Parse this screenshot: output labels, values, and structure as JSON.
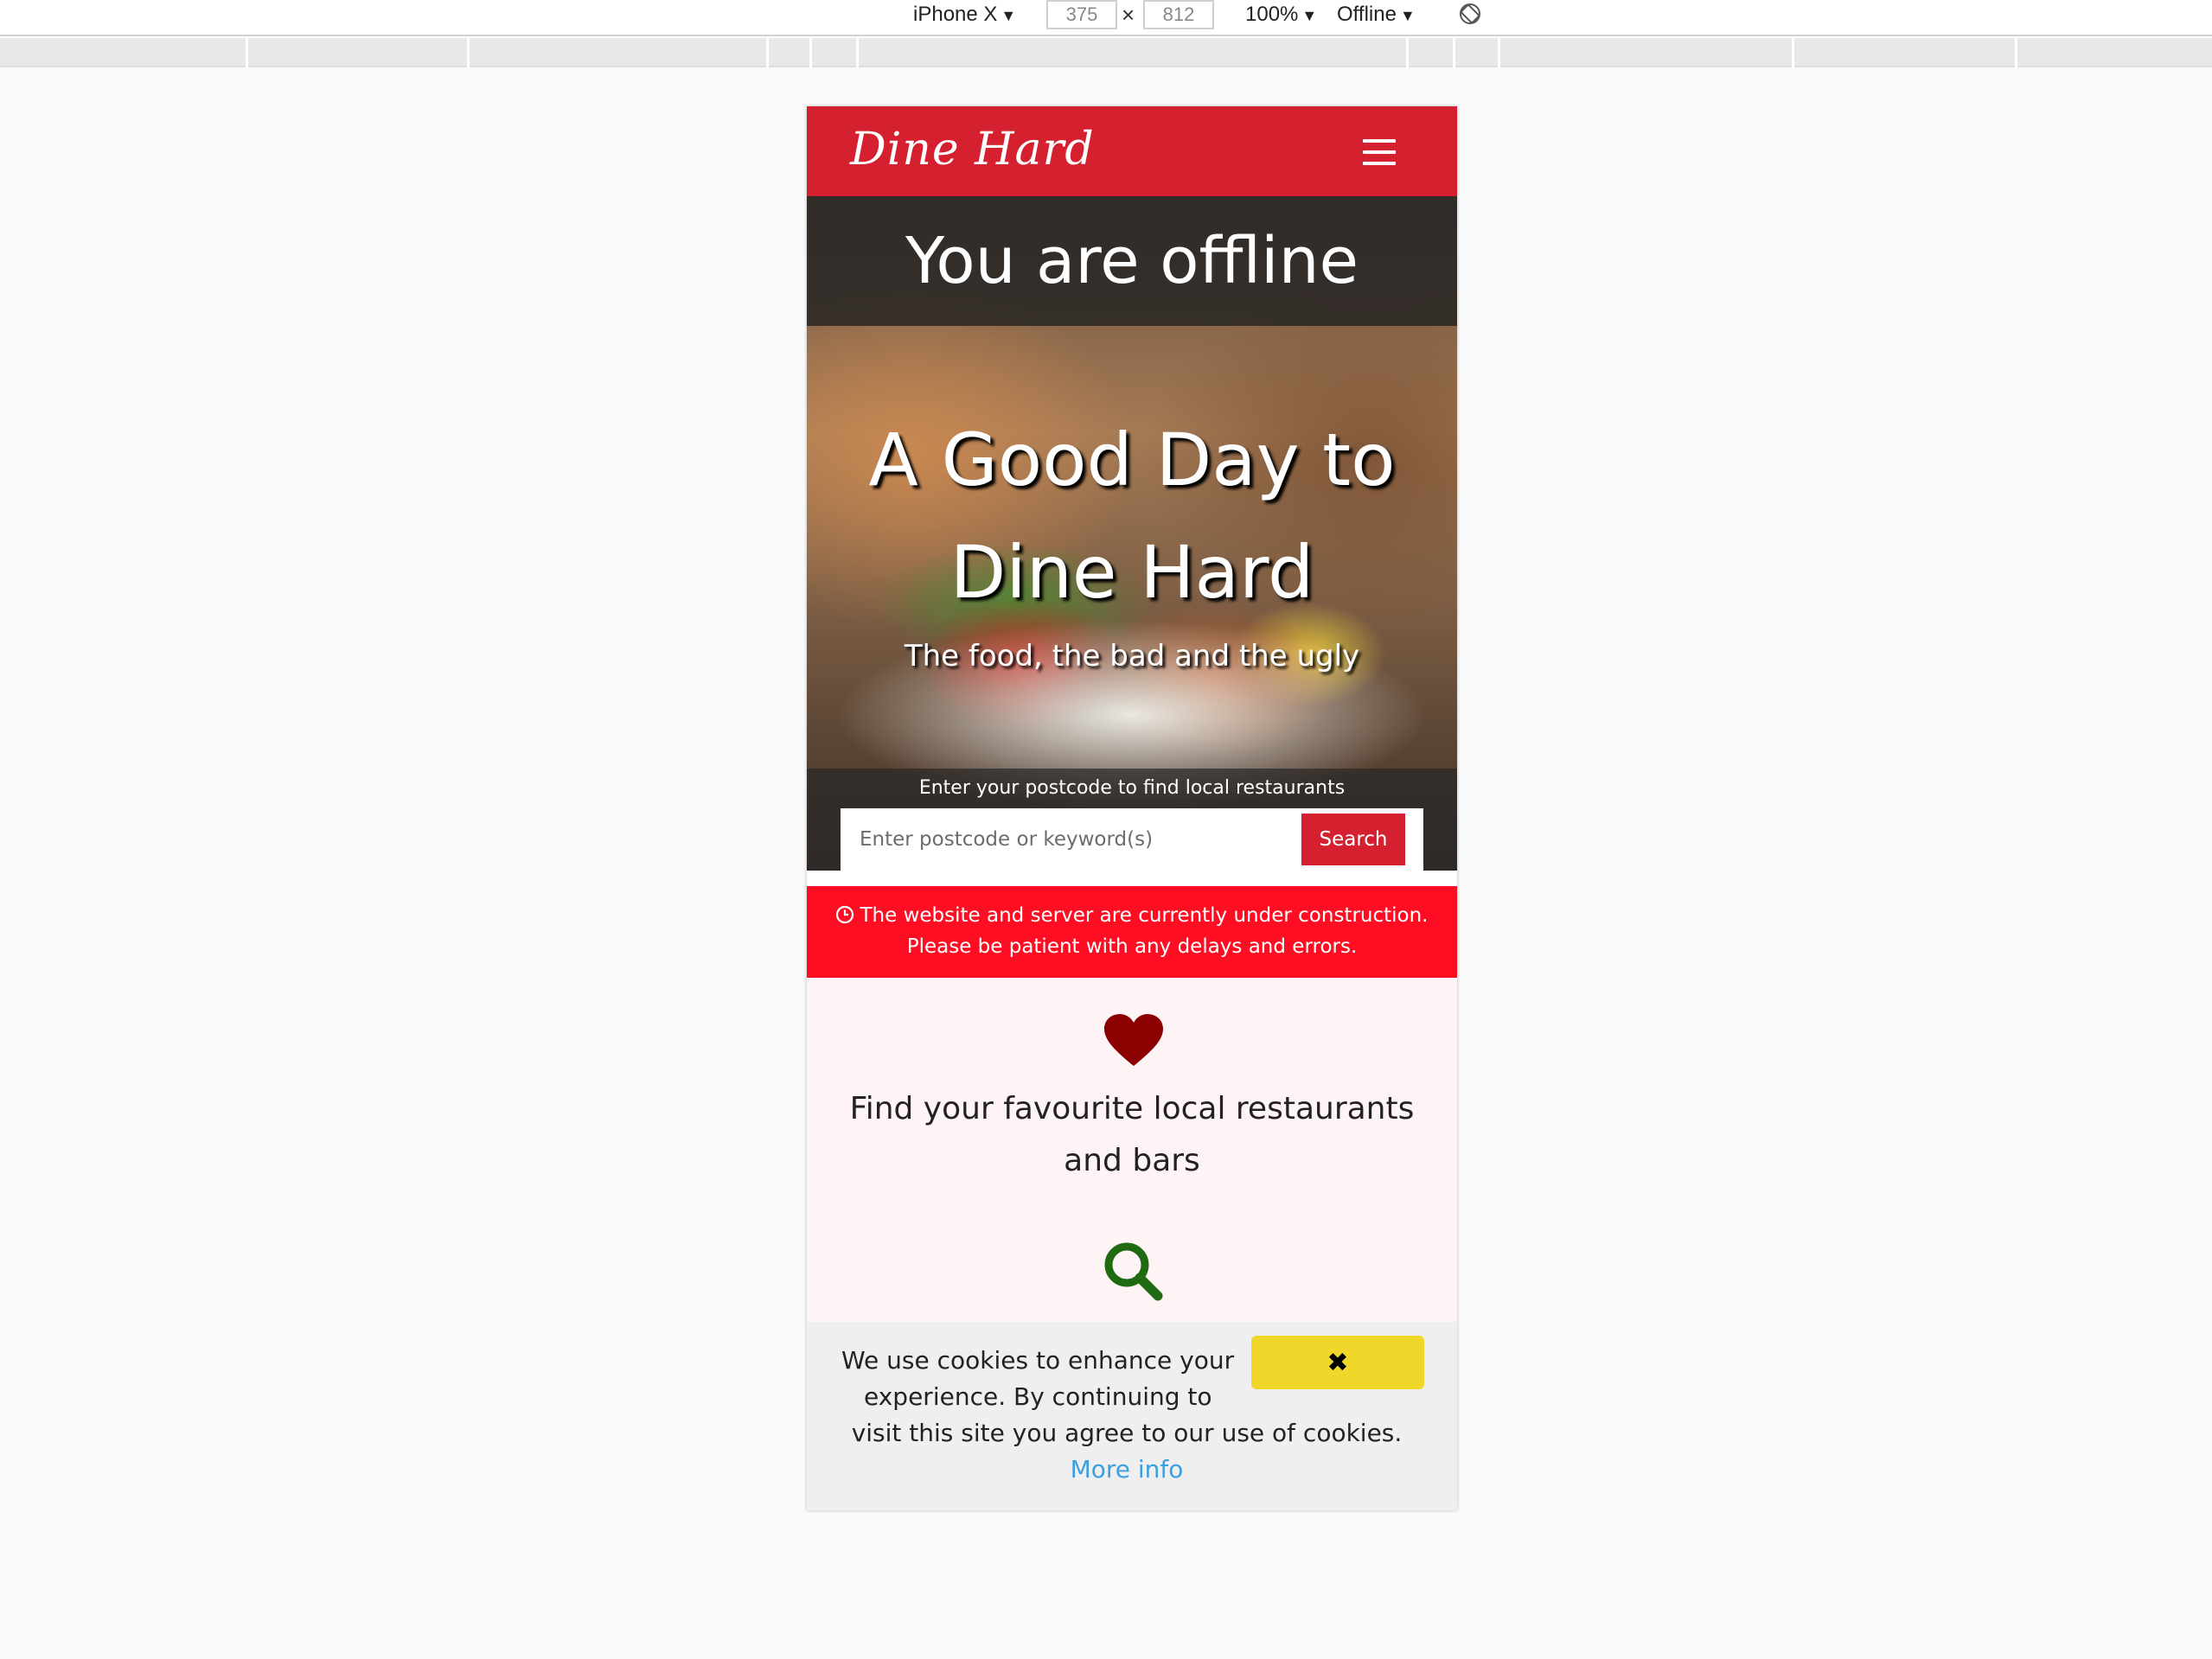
{
  "devtools": {
    "device_name": "iPhone X",
    "width": "375",
    "height": "812",
    "times": "×",
    "zoom": "100%",
    "throttling": "Offline",
    "caret": "▼"
  },
  "navbar": {
    "brand": "Dine Hard"
  },
  "hero": {
    "offline_message": "You are offline",
    "title": "A Good Day to Dine Hard",
    "subtitle": "The food, the bad and the ugly"
  },
  "search": {
    "label": "Enter your postcode to find local restaurants",
    "placeholder": "Enter postcode or keyword(s)",
    "button": "Search"
  },
  "notice": {
    "line1": "The website and server are currently under construction.",
    "line2": "Please be patient with any delays and errors."
  },
  "feature": {
    "text": "Find your favourite local restaurants and bars"
  },
  "cookie": {
    "line1": "We use cookies to enhance your",
    "line2": "experience. By continuing to",
    "line3": "visit this site you agree to our use of cookies.",
    "more_info": "More info",
    "close": "✖"
  },
  "colors": {
    "brand_red": "#d4202f",
    "notice_red": "#ff0d23",
    "heart": "#8b0000",
    "search_green": "#1e6b12",
    "cookie_button": "#f0d72a"
  }
}
